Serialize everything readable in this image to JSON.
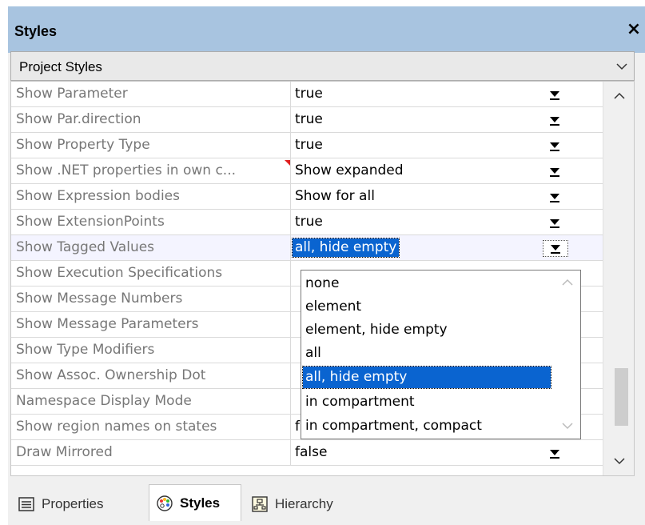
{
  "window": {
    "title": "Styles",
    "close": "×"
  },
  "project_styles": {
    "label": "Project Styles"
  },
  "rows": [
    {
      "name": "Show Parameter",
      "value": "true"
    },
    {
      "name": "Show Par.direction",
      "value": "true"
    },
    {
      "name": "Show Property Type",
      "value": "true"
    },
    {
      "name": "Show .NET properties in own c...",
      "value": "Show expanded"
    },
    {
      "name": "Show Expression bodies",
      "value": "Show for all"
    },
    {
      "name": "Show ExtensionPoints",
      "value": "true"
    },
    {
      "name": "Show Tagged Values",
      "value": "all, hide empty"
    },
    {
      "name": "Show Execution Specifications",
      "value": ""
    },
    {
      "name": "Show Message Numbers",
      "value": ""
    },
    {
      "name": "Show Message Parameters",
      "value": ""
    },
    {
      "name": "Show Type Modifiers",
      "value": ""
    },
    {
      "name": "Show Assoc. Ownership Dot",
      "value": ""
    },
    {
      "name": "Namespace Display Mode",
      "value": ""
    },
    {
      "name": "Show region names on states",
      "value": "false"
    },
    {
      "name": "Draw Mirrored",
      "value": "false"
    }
  ],
  "dropdown": {
    "options": [
      "none",
      "element",
      "element, hide empty",
      "all",
      "all, hide empty",
      "in compartment",
      "in compartment, compact"
    ],
    "selected": "all, hide empty"
  },
  "tabs": [
    {
      "label": "Properties",
      "icon": "properties-icon",
      "active": false
    },
    {
      "label": "Styles",
      "icon": "palette-icon",
      "active": true
    },
    {
      "label": "Hierarchy",
      "icon": "hierarchy-icon",
      "active": false
    }
  ],
  "colors": {
    "titlebar": "#a8c4e0",
    "selection": "#0a64d0",
    "modified_marker": "#e02020"
  }
}
